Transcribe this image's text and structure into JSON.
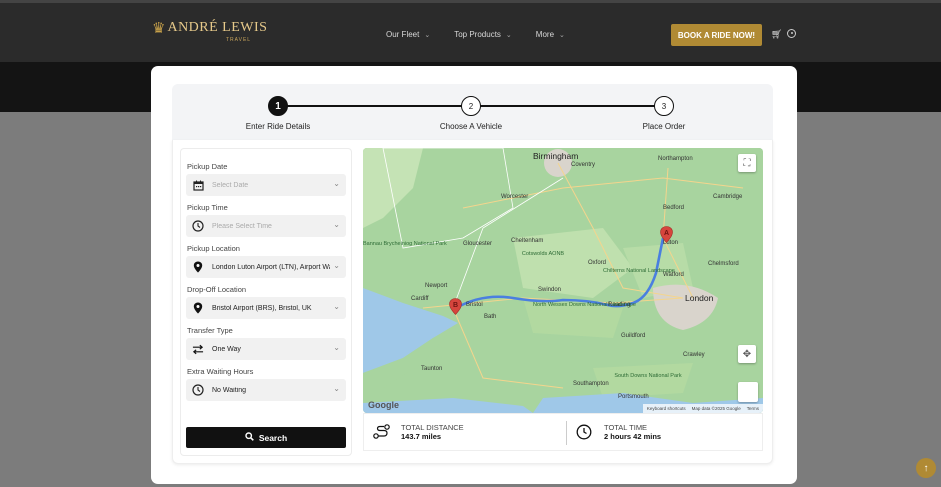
{
  "brand": {
    "name": "ANDRÉ LEWIS",
    "sub": "TRAVEL"
  },
  "nav": {
    "items": [
      {
        "label": "Our Fleet"
      },
      {
        "label": "Top Products"
      },
      {
        "label": "More"
      }
    ],
    "book_label": "BOOK A RIDE NOW!",
    "icons": [
      "cart-icon",
      "user-icon"
    ]
  },
  "steps": [
    {
      "number": "1",
      "label": "Enter Ride Details",
      "active": true
    },
    {
      "number": "2",
      "label": "Choose A Vehicle",
      "active": false
    },
    {
      "number": "3",
      "label": "Place Order",
      "active": false
    }
  ],
  "form": {
    "pickup_date": {
      "label": "Pickup Date",
      "placeholder": "Select Date",
      "icon": "calendar-icon"
    },
    "pickup_time": {
      "label": "Pickup Time",
      "placeholder": "Please Select Time",
      "icon": "clock-icon"
    },
    "pickup_location": {
      "label": "Pickup Location",
      "value": "London Luton Airport (LTN), Airport Way, Luton",
      "icon": "location-pin-icon"
    },
    "dropoff_location": {
      "label": "Drop-Off Location",
      "value": "Bristol Airport (BRS), Bristol, UK",
      "icon": "location-pin-icon"
    },
    "transfer_type": {
      "label": "Transfer Type",
      "value": "One Way",
      "icon": "transfer-arrows-icon"
    },
    "extra_waiting": {
      "label": "Extra Waiting Hours",
      "value": "No Waiting",
      "icon": "clock-icon"
    },
    "search_label": "Search"
  },
  "map": {
    "cities": {
      "birmingham": "Birmingham",
      "london": "London",
      "bristol": "Bristol",
      "oxford": "Oxford",
      "cambridge": "Cambridge",
      "gloucester": "Gloucester",
      "cheltenham": "Cheltenham",
      "swindon": "Swindon",
      "reading": "Reading",
      "luton": "Luton",
      "watford": "Watford",
      "chelmsford": "Chelmsford",
      "southampton": "Southampton",
      "portsmouth": "Portsmouth",
      "bath": "Bath",
      "newport": "Newport",
      "cardiff": "Cardiff",
      "coventry": "Coventry",
      "worcester": "Worcester",
      "northampton": "Northampton",
      "bedford": "Bedford",
      "crawley": "Crawley",
      "guildford": "Guildford",
      "taunton": "Taunton"
    },
    "parks": {
      "cotswolds": "Cotswolds AONB",
      "north_wessex": "North Wessex Downs National Landscape",
      "chilterns": "Chilterns National Landscape",
      "south_downs": "South Downs National Park",
      "brecon": "Bannau Brycheiniog National Park"
    },
    "marker_a": "A",
    "marker_b": "B",
    "google": "Google",
    "shortcuts": "Keyboard shortcuts",
    "attribution": "Map data ©2025 Google",
    "terms": "Terms"
  },
  "stats": {
    "distance_label": "TOTAL DISTANCE",
    "distance_value": "143.7 miles",
    "time_label": "TOTAL TIME",
    "time_value": "2 hours 42 mins"
  },
  "colors": {
    "accent": "#b08a34",
    "route": "#4a7fe0",
    "marker": "#d6453d",
    "map_green": "#a9d3a0"
  }
}
